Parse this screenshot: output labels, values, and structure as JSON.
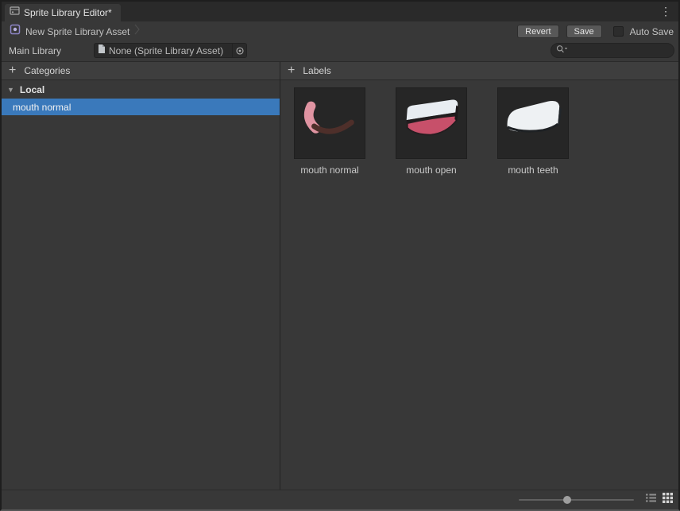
{
  "window": {
    "tab_title": "Sprite Library Editor*"
  },
  "icons": {
    "kebab": "⋮",
    "plus": "+",
    "foldout": "▼"
  },
  "toolbar": {
    "asset_name": "New Sprite Library Asset",
    "revert_label": "Revert",
    "save_label": "Save",
    "auto_save_label": "Auto Save"
  },
  "main_library": {
    "label": "Main Library",
    "object_value": "None (Sprite Library Asset)",
    "search_placeholder": ""
  },
  "categories": {
    "header": "Categories",
    "group_label": "Local",
    "items": [
      {
        "label": "mouth normal",
        "selected": true
      }
    ]
  },
  "labels": {
    "header": "Labels",
    "items": [
      {
        "label": "mouth normal"
      },
      {
        "label": "mouth open"
      },
      {
        "label": "mouth teeth"
      }
    ]
  },
  "colors": {
    "selection_blue": "#3a79bb",
    "panel_bg": "#383838",
    "thumb_bg": "#262626",
    "button_bg": "#585858"
  }
}
